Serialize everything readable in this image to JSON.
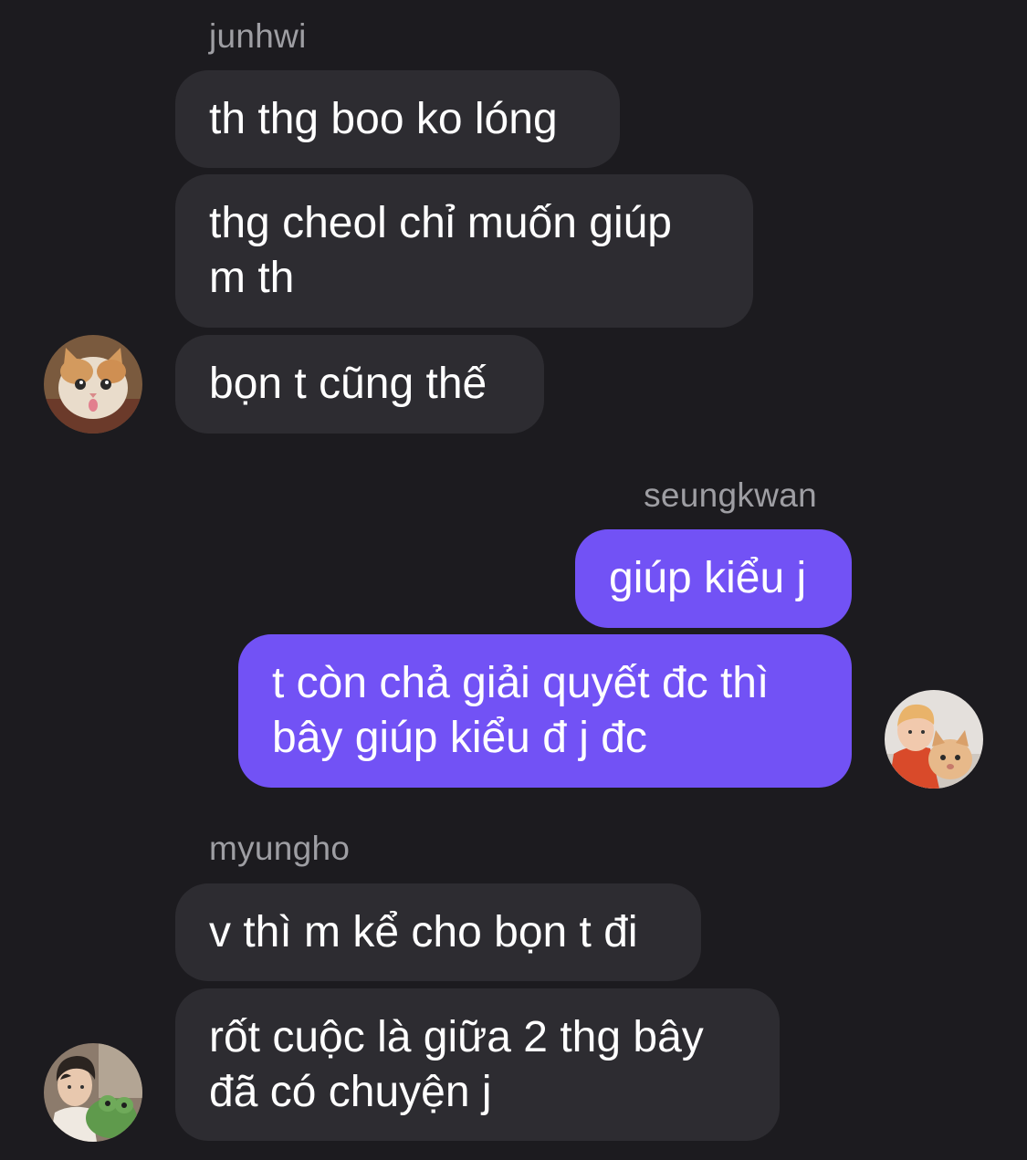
{
  "conversation": {
    "senders": {
      "junhwi": "junhwi",
      "seungkwan": "seungkwan",
      "myungho": "myungho"
    },
    "messages": [
      {
        "sender": "junhwi",
        "side": "incoming",
        "lines": [
          "th thg boo ko lóng"
        ]
      },
      {
        "sender": "junhwi",
        "side": "incoming",
        "lines": [
          "thg cheol chỉ muốn giúp",
          "m th"
        ]
      },
      {
        "sender": "junhwi",
        "side": "incoming",
        "lines": [
          "bọn t cũng thế"
        ]
      },
      {
        "sender": "seungkwan",
        "side": "outgoing",
        "lines": [
          "giúp kiểu j"
        ]
      },
      {
        "sender": "seungkwan",
        "side": "outgoing",
        "lines": [
          "t còn chả giải quyết đc thì",
          "bây giúp kiểu đ j đc"
        ]
      },
      {
        "sender": "myungho",
        "side": "incoming",
        "lines": [
          "v thì m kể cho bọn t đi"
        ]
      },
      {
        "sender": "myungho",
        "side": "incoming",
        "lines": [
          "rốt cuộc là giữa 2 thg bây",
          "đã có chuyện j"
        ]
      }
    ],
    "avatars": [
      {
        "sender": "junhwi",
        "icon": "cat-avatar"
      },
      {
        "sender": "seungkwan",
        "icon": "person-with-cat-avatar"
      },
      {
        "sender": "myungho",
        "icon": "person-with-plush-avatar"
      }
    ]
  },
  "colors": {
    "background": "#1c1b1f",
    "incoming_bubble": "#2d2c31",
    "outgoing_bubble": "#7252f5",
    "sender_name": "#9e9ea3",
    "message_text": "#ffffff"
  }
}
